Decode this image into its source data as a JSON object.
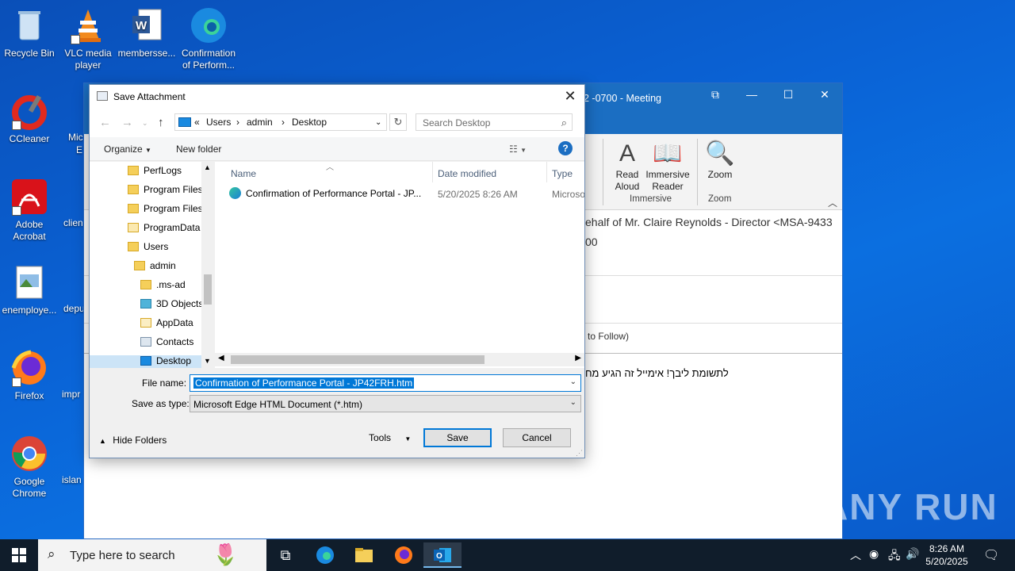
{
  "desktop": {
    "icons": [
      {
        "label": "Recycle Bin"
      },
      {
        "label": "VLC media player"
      },
      {
        "label": "membersse..."
      },
      {
        "label": "Confirmation of Perform..."
      },
      {
        "label": "CCleaner"
      },
      {
        "label": "Adobe Acrobat"
      },
      {
        "label": "enemploye..."
      },
      {
        "label": "Firefox"
      },
      {
        "label": "Google Chrome"
      }
    ],
    "partial_labels": [
      "Mic",
      "E",
      "clien",
      "depu",
      "impr",
      "islan"
    ]
  },
  "outlook": {
    "title_fragment": "2 -0700  -  Meeting",
    "ribbon": {
      "read_aloud": "Read Aloud",
      "immersive_reader": "Immersive Reader",
      "immersive_group": "Immersive",
      "zoom": "Zoom",
      "zoom_group": "Zoom"
    },
    "from_fragment": "ehalf of Mr. Claire Reynolds - Director <MSA-9433",
    "time_fragment": "00",
    "follow_fragment": "to Follow)",
    "body_fragment": "לתשומת ליבך! אימייל זה הגיע מח"
  },
  "dialog": {
    "title": "Save Attachment",
    "breadcrumb": [
      "«",
      "Users",
      "admin",
      "Desktop"
    ],
    "search_placeholder": "Search Desktop",
    "toolbar": {
      "organize": "Organize",
      "new_folder": "New folder"
    },
    "tree": [
      {
        "label": "PerfLogs"
      },
      {
        "label": "Program Files"
      },
      {
        "label": "Program Files"
      },
      {
        "label": "ProgramData"
      },
      {
        "label": "Users"
      },
      {
        "label": "admin"
      },
      {
        "label": ".ms-ad"
      },
      {
        "label": "3D Objects"
      },
      {
        "label": "AppData"
      },
      {
        "label": "Contacts"
      },
      {
        "label": "Desktop"
      }
    ],
    "columns": {
      "name": "Name",
      "date": "Date modified",
      "type": "Type"
    },
    "files": [
      {
        "name": "Confirmation of Performance Portal - JP...",
        "date": "5/20/2025 8:26 AM",
        "type": "Microso"
      }
    ],
    "file_name_label": "File name:",
    "file_name_value": "Confirmation of Performance Portal - JP42FRH.htm",
    "save_type_label": "Save as type:",
    "save_type_value": "Microsoft Edge HTML Document (*.htm)",
    "hide_folders": "Hide Folders",
    "tools": "Tools",
    "save": "Save",
    "cancel": "Cancel"
  },
  "taskbar": {
    "search_placeholder": "Type here to search",
    "time": "8:26 AM",
    "date": "5/20/2025"
  },
  "watermark": "ANY RUN"
}
